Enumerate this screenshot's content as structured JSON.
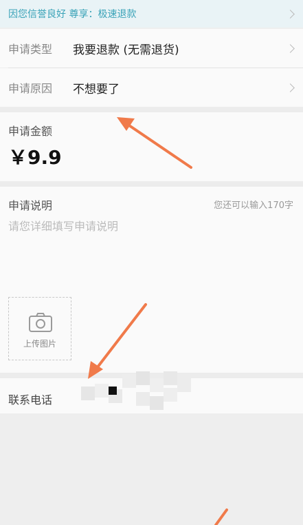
{
  "banner": {
    "text": "因您信誉良好 尊享：极速退款"
  },
  "form": {
    "type_label": "申请类型",
    "type_value": "我要退款 (无需退货)",
    "reason_label": "申请原因",
    "reason_value": "不想要了"
  },
  "amount": {
    "label": "申请金额",
    "value": "￥9.9"
  },
  "description": {
    "label": "申请说明",
    "counter": "您还可以输入170字",
    "placeholder": "请您详细填写申请说明"
  },
  "upload": {
    "label": "上传图片",
    "icon": "camera-icon"
  },
  "contact": {
    "label": "联系电话"
  },
  "colors": {
    "accent": "#3aa3b8",
    "arrow": "#f07a4a",
    "background": "#fafafa"
  }
}
